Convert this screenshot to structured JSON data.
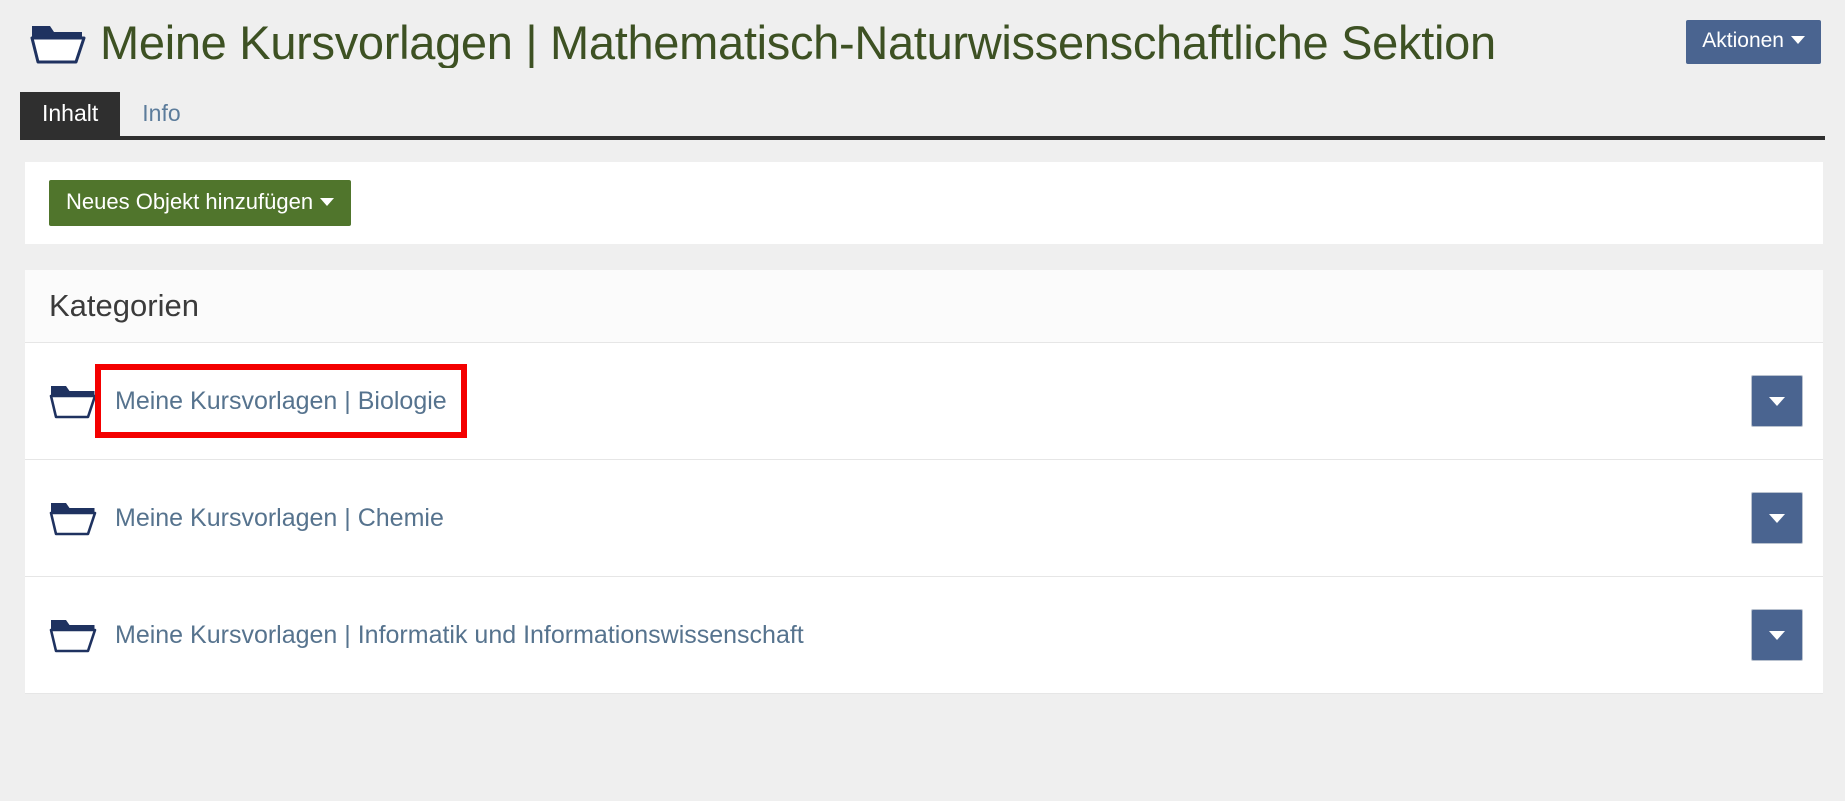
{
  "header": {
    "folder_icon": "folder-icon",
    "title": "Meine Kursvorlagen | Mathematisch-Naturwissenschaftliche Sektion",
    "actions_button": "Aktionen",
    "title_color": "#3d5123",
    "actions_button_color": "#4a6490"
  },
  "tabs": [
    {
      "label": "Inhalt",
      "active": true
    },
    {
      "label": "Info",
      "active": false
    }
  ],
  "toolbar": {
    "add_object_label": "Neues Objekt hinzufügen",
    "add_object_color": "#50752c"
  },
  "content": {
    "section_title": "Kategorien",
    "rows": [
      {
        "icon": "folder-icon",
        "label": "Meine Kursvorlagen | Biologie",
        "highlighted": true,
        "menu_icon": "chevron-down-icon"
      },
      {
        "icon": "folder-icon",
        "label": "Meine Kursvorlagen | Chemie",
        "highlighted": false,
        "menu_icon": "chevron-down-icon"
      },
      {
        "icon": "folder-icon",
        "label": "Meine Kursvorlagen | Informatik und Informationswissenschaft",
        "highlighted": false,
        "menu_icon": "chevron-down-icon"
      }
    ]
  },
  "colors": {
    "highlight_box": "#f40000",
    "link": "#56738e",
    "folder_icon": "#1f3260",
    "page_background": "#efefef"
  }
}
